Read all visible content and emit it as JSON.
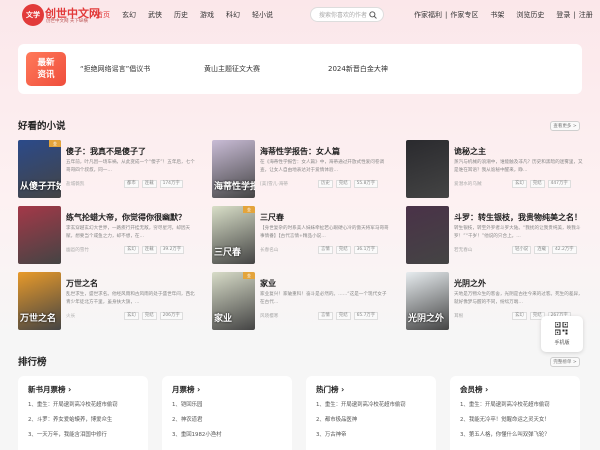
{
  "header": {
    "logo_mark": "文学",
    "logo_text": "创世中文网",
    "logo_sub": "创世中文网 天下纵横",
    "nav": [
      "首页",
      "玄幻",
      "武侠",
      "历史",
      "游戏",
      "科幻",
      "轻小说"
    ],
    "search_placeholder": "搜索你喜欢的作者",
    "right_links": {
      "author_welfare": "作家福利",
      "author_zone": "作家专区",
      "bookshelf": "书架",
      "history": "浏览历史",
      "login": "登录",
      "register": "注册"
    },
    "accent_color": "#e23a3a"
  },
  "news": {
    "badge_line1": "最新",
    "badge_line2": "资讯",
    "items": [
      "“拒绝网络谣言”倡议书",
      "黄山主题征文大赛",
      "2024新晋白金大神"
    ]
  },
  "good_books": {
    "title": "好看的小说",
    "more": "查看更多 >",
    "books": [
      {
        "title": "傻子：我真不是傻子了",
        "cover_text": "从傻子开始",
        "desc": "五年前，叶凡因一场车祸，从此变成一个“傻子”！五年后，七个哥哥四个叔叔，同一…",
        "author": "盐城薇凯",
        "tags": [
          "都市",
          "连载",
          "174万字"
        ],
        "cover_color": "#2b4a8a",
        "gold": true
      },
      {
        "title": "海蒂性学报告：女人篇",
        "cover_text": "海蒂性学报告",
        "desc": "在《海蒂性学报告：女人篇》中，海蒂通过开放式性爱问卷调查，让女人自由地表达对于爱情体验…",
        "author": "[美]雪儿·海蒂",
        "tags": [
          "历史",
          "完结",
          "55.8万字"
        ],
        "cover_color": "#c9bcd6",
        "gold": false
      },
      {
        "title": "诡秘之主",
        "cover_text": "",
        "desc": "蒸汽与机械的浪潮中，谁能触及非凡？历史和黑暗的迷雾里，又是谁在耳语？我从诡秘中醒来，睁…",
        "author": "爱潜水的乌贼",
        "tags": [
          "玄幻",
          "完结",
          "447万字"
        ],
        "cover_color": "#2a2a2e",
        "gold": false
      },
      {
        "title": "练气抡蜡大帝，你觉得你很幽默？",
        "cover_text": "",
        "desc": "李玄穿越玄幻大世界，一路疾行开挂无敌，穷尽星河，却因天赋，想要当个咸鱼之力，却不想，在…",
        "author": "幽邑的雪竹",
        "tags": [
          "玄幻",
          "连载",
          "39.2万字"
        ],
        "cover_color": "#a43848",
        "gold": false
      },
      {
        "title": "三尺春",
        "cover_text": "三尺春",
        "desc": "【身世复杂的时系美人妹妹牵扯若心眼硬心冷的傲天将军马哥哥事情番】【古代言情+精品小说…",
        "author": "长春名山",
        "tags": [
          "言情",
          "完结",
          "36.1万字"
        ],
        "cover_color": "#d9dfc8",
        "gold": true
      },
      {
        "title": "斗罗：转生银枝，我贵物纯美之名！",
        "cover_text": "",
        "desc": "转生银枝，转至外罗者斗罗大陆。“我扰的让我贵纯美，唤我斗罗！”“千岁！”他说的只合上。…",
        "author": "若无春山",
        "tags": [
          "轻小说",
          "连载",
          "42.2万字"
        ],
        "cover_color": "#4a3248",
        "gold": false
      },
      {
        "title": "万世之名",
        "cover_text": "万世之名",
        "desc": "乱世求生，盛世求名。他经风雨和古风雨的处于盛世年间，西北青少年徒北方千里，虽身扶大旗，…",
        "author": "火长",
        "tags": [
          "玄幻",
          "完结",
          "206万字"
        ],
        "cover_color": "#e89a2a",
        "gold": false
      },
      {
        "title": "家业",
        "cover_text": "家业",
        "desc": "家业复兴！家破重科！奋斗是必然的。……“这是一个现代女子在古代…",
        "author": "风晓樱寒",
        "tags": [
          "言情",
          "完结",
          "65.7万字"
        ],
        "cover_color": "#d8dcc8",
        "gold": true
      },
      {
        "title": "光阴之外",
        "cover_text": "光阴之外",
        "desc": "天地是万物众生的客舍，光阴是古往今来的过客。死生的差异，就好像梦与醒的不同，纷纭万端…",
        "author": "耳根",
        "tags": [
          "玄幻",
          "完结",
          "267万字"
        ],
        "cover_color": "#e7ecef",
        "gold": false
      }
    ]
  },
  "rankings": {
    "title": "排行榜",
    "more": "完整榜单 >",
    "cards": [
      {
        "title": "新书月票榜 ›",
        "items": [
          "1、重生：开局逮到高冷校花超市偷窃",
          "2、斗罗：养女爱蛤蟆养，博爱众生",
          "3、一天万年，我能含泪国中修行"
        ]
      },
      {
        "title": "月票榜 ›",
        "items": [
          "1、铠回乐园",
          "2、神农道君",
          "3、重回1982小渔村"
        ]
      },
      {
        "title": "热门榜 ›",
        "items": [
          "1、重生：开局逮到高冷校花超市偷窃",
          "2、都市极品医神",
          "3、万古神帝"
        ]
      },
      {
        "title": "会员榜 ›",
        "items": [
          "1、重生：开局逮到高冷校花超市偷窃",
          "2、我能无冷卒！觉醒命运之灵天女！",
          "3、第五人格，你懂什么叫双弹飞轮？"
        ]
      }
    ]
  },
  "app_float": {
    "label": "手机版"
  }
}
